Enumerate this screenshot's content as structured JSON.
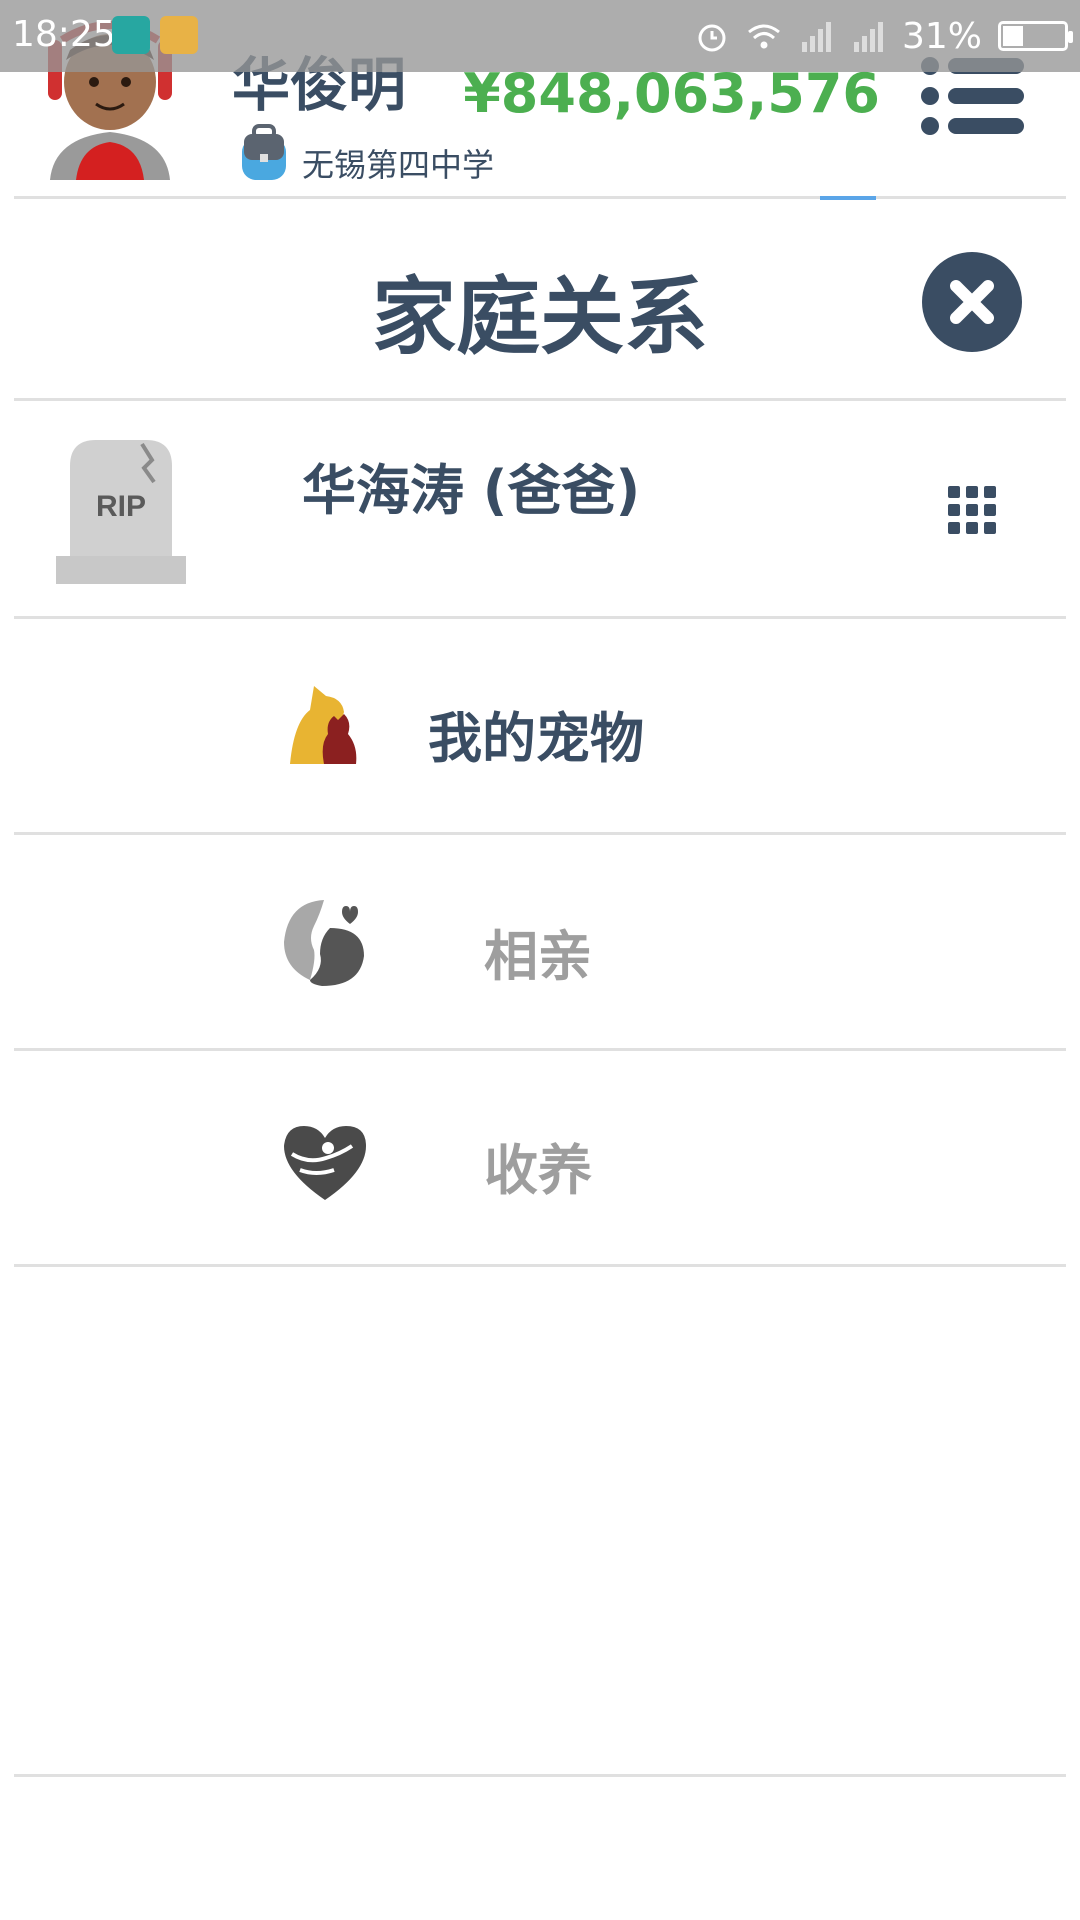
{
  "status_bar": {
    "time": "18:25",
    "battery": "31%",
    "icons": [
      "alarm-icon",
      "wifi-icon",
      "signal-icon",
      "signal-icon",
      "battery-icon"
    ]
  },
  "header": {
    "user_name": "华俊明",
    "school": "无锡第四中学",
    "money": "¥848,063,576",
    "money_color": "#4caf50"
  },
  "dialog": {
    "title": "家庭关系",
    "close_icon": "close-icon"
  },
  "relations": [
    {
      "name": "华海涛 (爸爸)",
      "icon": "rip-tombstone-icon",
      "action_icon": "grid-dots-icon"
    }
  ],
  "menu": [
    {
      "label": "我的宠物",
      "icon": "pet-icon",
      "enabled": true
    },
    {
      "label": "相亲",
      "icon": "blind-date-icon",
      "enabled": false
    },
    {
      "label": "收养",
      "icon": "adopt-heart-icon",
      "enabled": false
    }
  ],
  "colors": {
    "primary_text": "#3a4d63",
    "disabled_text": "#9e9e9e",
    "accent_green": "#4caf50"
  }
}
